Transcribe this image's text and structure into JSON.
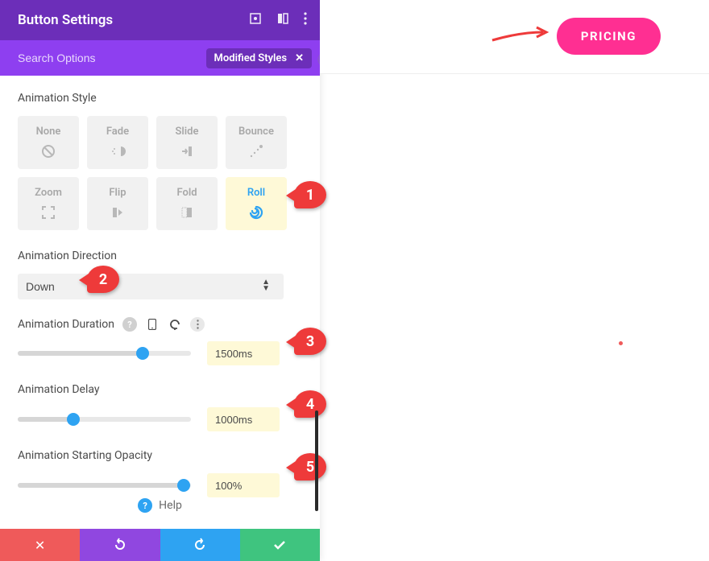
{
  "header": {
    "title": "Button Settings"
  },
  "search": {
    "placeholder": "Search Options",
    "tag_label": "Modified Styles"
  },
  "sections": {
    "animation_style": {
      "label": "Animation Style"
    },
    "animation_direction": {
      "label": "Animation Direction",
      "value": "Down"
    },
    "animation_duration": {
      "label": "Animation Duration",
      "value": "1500ms",
      "percent": 72
    },
    "animation_delay": {
      "label": "Animation Delay",
      "value": "1000ms",
      "percent": 32
    },
    "animation_opacity": {
      "label": "Animation Starting Opacity",
      "value": "100%",
      "percent": 96
    }
  },
  "styles": [
    {
      "key": "none",
      "label": "None"
    },
    {
      "key": "fade",
      "label": "Fade"
    },
    {
      "key": "slide",
      "label": "Slide"
    },
    {
      "key": "bounce",
      "label": "Bounce"
    },
    {
      "key": "zoom",
      "label": "Zoom"
    },
    {
      "key": "flip",
      "label": "Flip"
    },
    {
      "key": "fold",
      "label": "Fold"
    },
    {
      "key": "roll",
      "label": "Roll",
      "selected": true
    }
  ],
  "help": {
    "label": "Help"
  },
  "preview": {
    "button_label": "PRICING"
  },
  "callouts": {
    "c1": "1",
    "c2": "2",
    "c3": "3",
    "c4": "4",
    "c5": "5"
  }
}
